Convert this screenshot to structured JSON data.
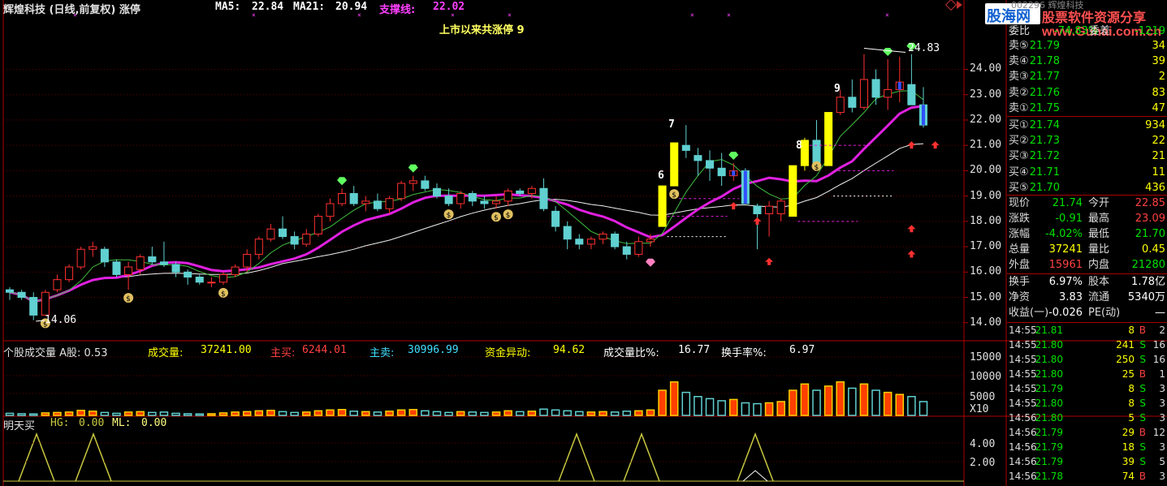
{
  "header": {
    "stock_title": "辉煌科技 (日线,前复权) 涨停",
    "ma5_label": "MA5:",
    "ma5_value": "22.84",
    "ma21_label": "MA21:",
    "ma21_value": "20.94",
    "support_label": "支撑线:",
    "support_value": "22.02",
    "limit_up_note": "上市以来共涨停  9",
    "high_mark": "24.83",
    "low_mark": "14.06"
  },
  "vol_header": {
    "title": "个股成交量 A股: 0.53",
    "vol_label": "成交量:",
    "vol_value": "37241.00",
    "buy_label": "主买:",
    "buy_value": "6244.01",
    "sell_label": "主卖:",
    "sell_value": "30996.99",
    "fund_label": "资金异动:",
    "fund_value": "94.62",
    "ratio_label": "成交量比%:",
    "ratio_value": "16.77",
    "turnover_label": "换手率%:",
    "turnover_value": "6.97"
  },
  "ind_header": {
    "title": "明天买",
    "hg_label": "HG:",
    "hg_value": "0.00",
    "ml_label": "ML:",
    "ml_value": "0.00"
  },
  "price_axis": [
    "24.00",
    "23.00",
    "22.00",
    "21.00",
    "20.00",
    "19.00",
    "18.00",
    "17.00",
    "16.00",
    "15.00",
    "14.00"
  ],
  "vol_axis": [
    "15000",
    "10000",
    "5000",
    "X10"
  ],
  "ind_axis": [
    "4.00",
    "2.00"
  ],
  "limit_counts": [
    "6",
    "7",
    "8",
    "9"
  ],
  "watermark": {
    "logo": "股海网",
    "line1": "股票软件资源分享",
    "url": "www.Guhai.com.cn",
    "code": "002296",
    "name": "辉煌科技"
  },
  "quote": {
    "webi_label": "委比",
    "webi_value": "-74.83%",
    "weicha_label": "委差",
    "weicha_value": "-1219",
    "asks": [
      {
        "label": "卖⑤",
        "price": "21.79",
        "vol": "34"
      },
      {
        "label": "卖④",
        "price": "21.78",
        "vol": "39"
      },
      {
        "label": "卖③",
        "price": "21.77",
        "vol": "2"
      },
      {
        "label": "卖②",
        "price": "21.76",
        "vol": "83"
      },
      {
        "label": "卖①",
        "price": "21.75",
        "vol": "47"
      }
    ],
    "bids": [
      {
        "label": "买①",
        "price": "21.74",
        "vol": "934"
      },
      {
        "label": "买②",
        "price": "21.73",
        "vol": "22"
      },
      {
        "label": "买③",
        "price": "21.72",
        "vol": "21"
      },
      {
        "label": "买④",
        "price": "21.71",
        "vol": "11"
      },
      {
        "label": "买⑤",
        "price": "21.70",
        "vol": "436"
      }
    ],
    "stats": [
      {
        "l1": "现价",
        "v1": "21.74",
        "c1": "#00e000",
        "l2": "今开",
        "v2": "22.85",
        "c2": "#ff4040"
      },
      {
        "l1": "涨跌",
        "v1": "-0.91",
        "c1": "#00e000",
        "l2": "最高",
        "v2": "23.09",
        "c2": "#ff4040"
      },
      {
        "l1": "涨幅",
        "v1": "-4.02%",
        "c1": "#00e000",
        "l2": "最低",
        "v2": "21.70",
        "c2": "#00e000"
      },
      {
        "l1": "总量",
        "v1": "37241",
        "c1": "#ffff00",
        "l2": "量比",
        "v2": "0.45",
        "c2": "#ffff00"
      },
      {
        "l1": "外盘",
        "v1": "15961",
        "c1": "#ff4040",
        "l2": "内盘",
        "v2": "21280",
        "c2": "#00e000"
      }
    ],
    "stats2": [
      {
        "l1": "换手",
        "v1": "6.97%",
        "l2": "股本",
        "v2": "1.78亿"
      },
      {
        "l1": "净资",
        "v1": "3.83",
        "l2": "流通",
        "v2": "5340万"
      },
      {
        "l1": "收益(一)",
        "v1": "-0.026",
        "l2": "PE(动)",
        "v2": "—"
      }
    ]
  },
  "ticks": [
    {
      "time": "14:55",
      "price": "21.81",
      "vol": "8",
      "bs": "B",
      "n": "2"
    },
    {
      "time": "14:55",
      "price": "21.80",
      "vol": "241",
      "bs": "S",
      "n": "16"
    },
    {
      "time": "14:55",
      "price": "21.80",
      "vol": "250",
      "bs": "S",
      "n": "16"
    },
    {
      "time": "14:55",
      "price": "21.80",
      "vol": "25",
      "bs": "B",
      "n": "1"
    },
    {
      "time": "14:55",
      "price": "21.79",
      "vol": "8",
      "bs": "S",
      "n": "3"
    },
    {
      "time": "14:55",
      "price": "21.80",
      "vol": "8",
      "bs": "S",
      "n": "3"
    },
    {
      "time": "14:56",
      "price": "21.80",
      "vol": "5",
      "bs": "S",
      "n": "3"
    },
    {
      "time": "14:56",
      "price": "21.79",
      "vol": "29",
      "bs": "B",
      "n": "12"
    },
    {
      "time": "14:56",
      "price": "21.79",
      "vol": "18",
      "bs": "S",
      "n": "3"
    },
    {
      "time": "14:56",
      "price": "21.79",
      "vol": "39",
      "bs": "S",
      "n": "5"
    },
    {
      "time": "14:56",
      "price": "21.78",
      "vol": "74",
      "bs": "B",
      "n": "3"
    }
  ],
  "chart_data": {
    "type": "candlestick",
    "candles": [
      [
        15.3,
        15.4,
        14.9,
        15.2
      ],
      [
        15.2,
        15.3,
        14.9,
        15.0
      ],
      [
        15.0,
        15.2,
        14.1,
        14.3
      ],
      [
        14.3,
        15.3,
        14.3,
        15.2
      ],
      [
        15.3,
        15.9,
        15.2,
        15.7
      ],
      [
        15.7,
        16.3,
        15.6,
        16.2
      ],
      [
        16.2,
        17.0,
        16.1,
        16.9
      ],
      [
        16.9,
        17.2,
        16.6,
        17.0
      ],
      [
        16.9,
        17.0,
        16.2,
        16.4
      ],
      [
        16.4,
        16.5,
        15.8,
        15.9
      ],
      [
        15.9,
        16.4,
        15.3,
        16.2
      ],
      [
        16.1,
        16.7,
        15.9,
        16.6
      ],
      [
        16.6,
        17.0,
        16.3,
        16.4
      ],
      [
        16.4,
        17.2,
        16.2,
        16.3
      ],
      [
        16.3,
        16.4,
        15.8,
        16.0
      ],
      [
        16.0,
        16.1,
        15.5,
        15.8
      ],
      [
        15.8,
        15.9,
        15.5,
        15.6
      ],
      [
        15.6,
        15.8,
        15.4,
        15.6
      ],
      [
        15.6,
        16.0,
        15.5,
        15.9
      ],
      [
        15.9,
        16.3,
        15.8,
        16.2
      ],
      [
        16.2,
        16.9,
        16.0,
        16.7
      ],
      [
        16.7,
        17.4,
        16.5,
        17.3
      ],
      [
        17.3,
        17.9,
        17.2,
        17.7
      ],
      [
        17.7,
        18.2,
        17.3,
        17.4
      ],
      [
        17.4,
        17.6,
        16.9,
        17.1
      ],
      [
        17.1,
        17.7,
        17.0,
        17.5
      ],
      [
        17.5,
        18.3,
        17.4,
        18.2
      ],
      [
        18.2,
        18.9,
        18.0,
        18.7
      ],
      [
        18.7,
        19.3,
        18.6,
        19.1
      ],
      [
        19.1,
        19.4,
        18.6,
        18.7
      ],
      [
        18.7,
        19.0,
        18.4,
        18.8
      ],
      [
        18.8,
        19.1,
        18.4,
        18.5
      ],
      [
        18.5,
        19.0,
        18.3,
        18.9
      ],
      [
        18.9,
        19.6,
        18.8,
        19.5
      ],
      [
        19.5,
        19.8,
        19.2,
        19.6
      ],
      [
        19.6,
        19.8,
        19.2,
        19.3
      ],
      [
        19.3,
        19.5,
        18.9,
        19.0
      ],
      [
        19.0,
        19.3,
        18.6,
        18.7
      ],
      [
        18.7,
        19.2,
        18.5,
        19.1
      ],
      [
        19.1,
        19.2,
        18.6,
        18.8
      ],
      [
        18.8,
        19.0,
        18.5,
        18.7
      ],
      [
        18.7,
        19.0,
        18.5,
        18.8
      ],
      [
        18.8,
        19.3,
        18.6,
        19.2
      ],
      [
        19.2,
        19.3,
        19.0,
        19.1
      ],
      [
        19.1,
        19.4,
        18.9,
        19.3
      ],
      [
        19.3,
        19.7,
        18.4,
        18.5
      ],
      [
        18.4,
        18.6,
        17.6,
        17.8
      ],
      [
        17.8,
        18.0,
        16.9,
        17.3
      ],
      [
        17.3,
        17.5,
        16.9,
        17.1
      ],
      [
        17.1,
        17.4,
        16.9,
        17.3
      ],
      [
        17.3,
        17.6,
        17.1,
        17.5
      ],
      [
        17.5,
        17.6,
        16.9,
        17.0
      ],
      [
        17.0,
        17.2,
        16.5,
        16.7
      ],
      [
        16.7,
        17.4,
        16.6,
        17.2
      ],
      [
        17.2,
        17.5,
        17.0,
        17.3
      ],
      [
        17.8,
        19.4,
        17.8,
        19.4
      ],
      [
        19.4,
        21.1,
        19.4,
        21.1
      ],
      [
        21.0,
        21.8,
        20.5,
        20.8
      ],
      [
        20.6,
        20.9,
        19.8,
        20.4
      ],
      [
        20.4,
        20.8,
        19.6,
        20.1
      ],
      [
        20.1,
        20.7,
        19.4,
        19.8
      ],
      [
        19.8,
        20.3,
        19.6,
        20.0
      ],
      [
        20.0,
        20.1,
        18.7,
        18.7
      ],
      [
        18.6,
        18.7,
        16.9,
        18.3
      ],
      [
        18.3,
        18.8,
        17.4,
        18.6
      ],
      [
        18.3,
        18.9,
        18.0,
        18.8
      ],
      [
        18.2,
        20.2,
        18.2,
        20.2
      ],
      [
        20.2,
        21.3,
        20.0,
        21.2
      ],
      [
        21.2,
        22.0,
        20.5,
        20.2
      ],
      [
        20.2,
        22.3,
        20.2,
        22.3
      ],
      [
        22.3,
        23.2,
        22.2,
        22.9
      ],
      [
        22.9,
        23.6,
        22.3,
        22.5
      ],
      [
        22.5,
        24.6,
        22.4,
        23.6
      ],
      [
        23.6,
        24.0,
        22.6,
        22.9
      ],
      [
        22.9,
        24.4,
        22.4,
        23.2
      ],
      [
        23.2,
        24.5,
        22.7,
        23.5
      ],
      [
        23.4,
        24.6,
        22.6,
        22.6
      ],
      [
        22.6,
        23.3,
        21.7,
        21.8
      ]
    ],
    "ma5_value": 22.84,
    "ma21_value": 20.94,
    "support_value": 22.02,
    "volume": [
      50,
      40,
      35,
      60,
      70,
      80,
      120,
      100,
      70,
      50,
      80,
      90,
      70,
      80,
      50,
      40,
      35,
      40,
      60,
      80,
      90,
      110,
      120,
      90,
      70,
      80,
      110,
      130,
      140,
      100,
      90,
      80,
      100,
      130,
      140,
      110,
      90,
      70,
      90,
      80,
      70,
      80,
      110,
      90,
      100,
      150,
      130,
      110,
      90,
      80,
      90,
      80,
      100,
      110,
      130,
      600,
      800,
      550,
      450,
      400,
      350,
      380,
      300,
      280,
      300,
      330,
      600,
      750,
      600,
      700,
      800,
      650,
      750,
      600,
      550,
      500,
      450,
      330
    ],
    "ylim": [
      13.8,
      25.2
    ]
  }
}
